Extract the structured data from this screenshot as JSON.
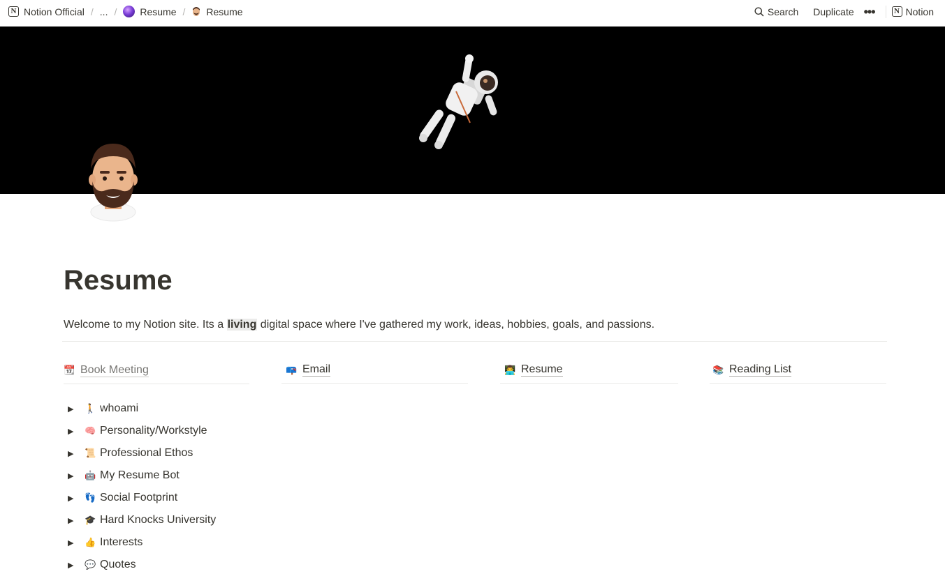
{
  "breadcrumbs": {
    "workspace": "Notion Official",
    "ellipsis": "...",
    "parent": "Resume",
    "current": "Resume",
    "separator": "/"
  },
  "topbar": {
    "search_label": "Search",
    "duplicate_label": "Duplicate",
    "more_label": "•••",
    "notion_label": "Notion"
  },
  "page": {
    "title": "Resume",
    "intro_before": "Welcome to my Notion site. Its a ",
    "intro_highlight": "living",
    "intro_after": " digital space where I've gathered my work, ideas, hobbies, goals, and passions."
  },
  "links": [
    {
      "emoji": "📆",
      "label": "Book Meeting"
    },
    {
      "emoji": "📪",
      "label": "Email"
    },
    {
      "emoji": "👨‍💻",
      "label": "Resume"
    },
    {
      "emoji": "📚",
      "label": "Reading List"
    }
  ],
  "toggles": [
    {
      "emoji": "🚶",
      "label": "whoami"
    },
    {
      "emoji": "🧠",
      "label": "Personality/Workstyle"
    },
    {
      "emoji": "📜",
      "label": "Professional Ethos"
    },
    {
      "emoji": "🤖",
      "label": "My Resume Bot"
    },
    {
      "emoji": "👣",
      "label": "Social Footprint"
    },
    {
      "emoji": "🎓",
      "label": "Hard Knocks University"
    },
    {
      "emoji": "👍",
      "label": "Interests"
    },
    {
      "emoji": "💬",
      "label": "Quotes"
    }
  ],
  "icons": {
    "notion": "notion-logo-icon",
    "parent": "purple-orb-icon",
    "page": "bearded-man-avatar-icon",
    "search": "search-icon",
    "cover": "astronaut-illustration",
    "toggle": "triangle-right-icon"
  },
  "colors": {
    "text": "#37352f",
    "cover": "#000000",
    "divider": "#e9e9e7",
    "muted": "#787774"
  }
}
